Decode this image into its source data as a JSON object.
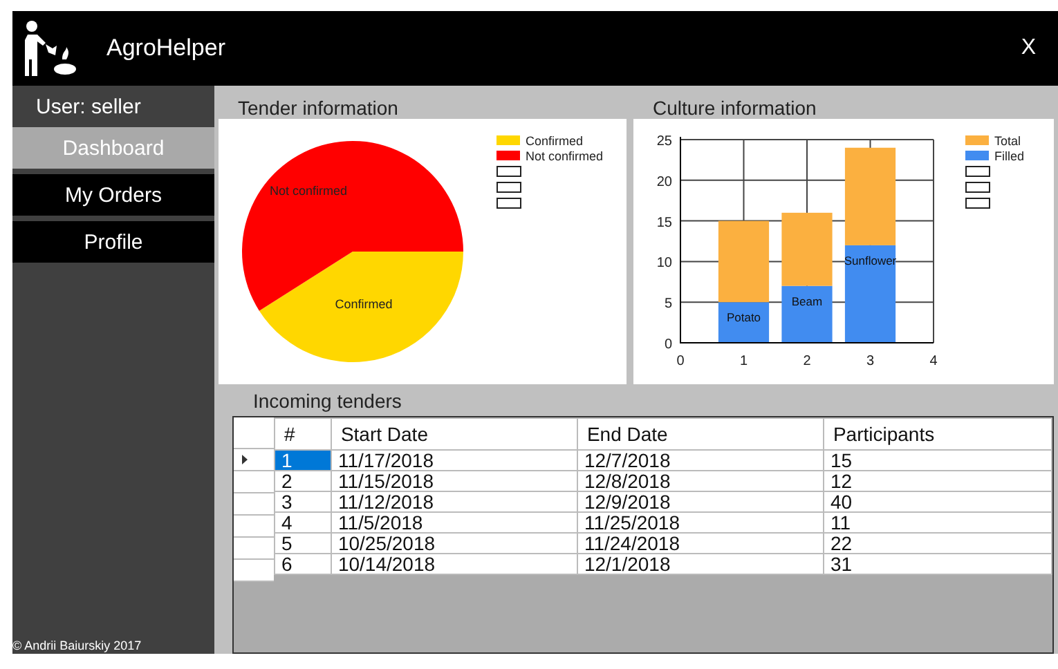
{
  "window": {
    "title": "AgroHelper",
    "close": "X"
  },
  "sidebar": {
    "user": "User: seller",
    "items": [
      {
        "label": "Dashboard",
        "selected": true
      },
      {
        "label": "My Orders",
        "selected": false
      },
      {
        "label": "Profile",
        "selected": false
      }
    ],
    "footer": "© Andrii Baiurskiy 2017"
  },
  "tender_information": {
    "title": "Tender information",
    "slice_labels": [
      "Confirmed",
      "Not confirmed"
    ],
    "legend": [
      {
        "label": "Confirmed",
        "color": "#ffd700"
      },
      {
        "label": "Not confirmed",
        "color": "#ff0000"
      }
    ]
  },
  "culture_information": {
    "title": "Culture information",
    "chart_data": {
      "type": "bar",
      "x": [
        1,
        2,
        3
      ],
      "series": [
        {
          "name": "Filled",
          "color": "#418cf0",
          "values": [
            5,
            7,
            12
          ]
        },
        {
          "name": "Total",
          "color": "#fbb040",
          "values": [
            10,
            9,
            12
          ]
        }
      ],
      "xlim": [
        0,
        4
      ],
      "ylim": [
        0,
        25
      ],
      "xticks": [
        0,
        1,
        2,
        3,
        4
      ],
      "yticks": [
        0,
        5,
        10,
        15,
        20,
        25
      ],
      "stacked": true,
      "grid": true,
      "legend": true,
      "annotations": [
        "Potato",
        "Beam",
        "Sunflower"
      ]
    }
  },
  "incoming_tenders": {
    "title": "Incoming tenders",
    "columns": [
      "#",
      "Start Date",
      "End Date",
      "Participants"
    ],
    "rows": [
      {
        "cells": [
          "1",
          "11/17/2018",
          "12/7/2018",
          "15"
        ],
        "selected": true
      },
      {
        "cells": [
          "2",
          "11/15/2018",
          "12/8/2018",
          "12"
        ],
        "selected": false
      },
      {
        "cells": [
          "3",
          "11/12/2018",
          "12/9/2018",
          "40"
        ],
        "selected": false
      },
      {
        "cells": [
          "4",
          "11/5/2018",
          "11/25/2018",
          "11"
        ],
        "selected": false
      },
      {
        "cells": [
          "5",
          "10/25/2018",
          "11/24/2018",
          "22"
        ],
        "selected": false
      },
      {
        "cells": [
          "6",
          "10/14/2018",
          "12/1/2018",
          "31"
        ],
        "selected": false
      }
    ]
  }
}
